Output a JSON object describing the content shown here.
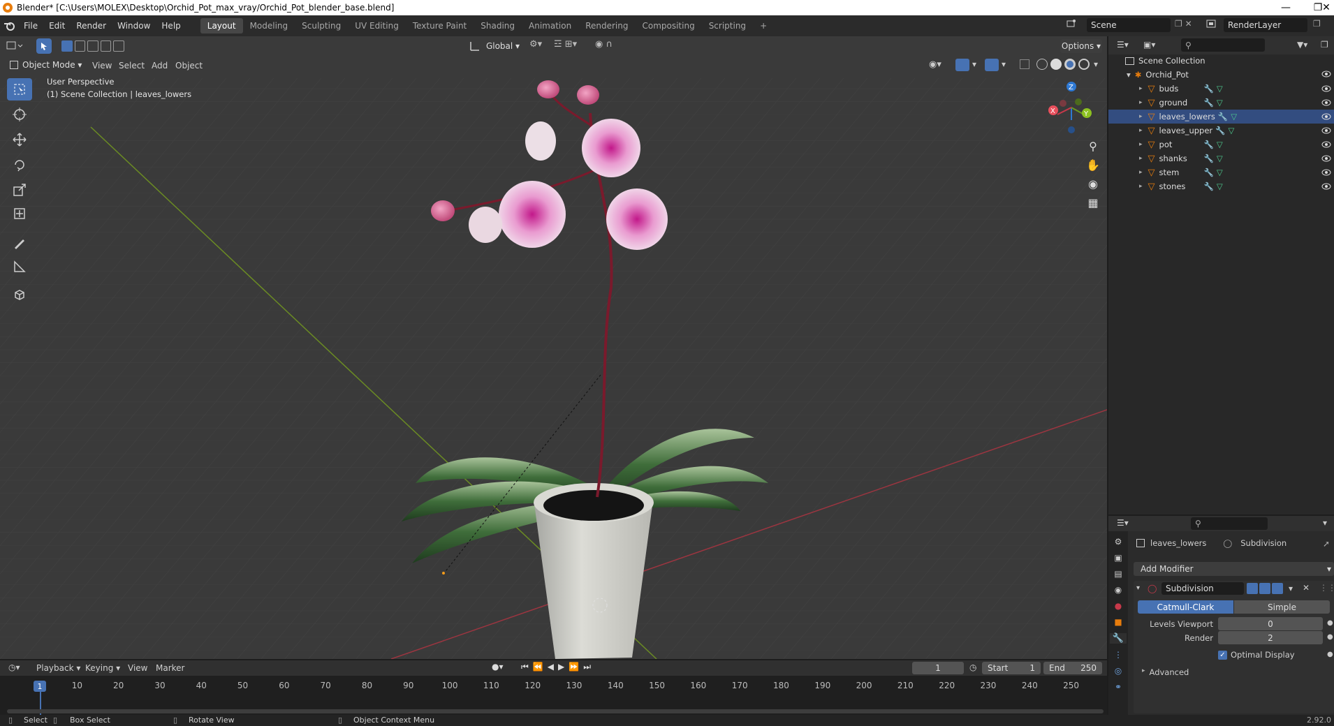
{
  "title": "Blender* [C:\\Users\\MOLEX\\Desktop\\Orchid_Pot_max_vray/Orchid_Pot_blender_base.blend]",
  "menu": [
    "File",
    "Edit",
    "Render",
    "Window",
    "Help"
  ],
  "workspaces": [
    "Layout",
    "Modeling",
    "Sculpting",
    "UV Editing",
    "Texture Paint",
    "Shading",
    "Animation",
    "Rendering",
    "Compositing",
    "Scripting"
  ],
  "scene_name": "Scene",
  "render_layer": "RenderLayer",
  "toolbar": {
    "orientation": "Global",
    "options": "Options"
  },
  "viewport": {
    "mode": "Object Mode",
    "menus": [
      "View",
      "Select",
      "Add",
      "Object"
    ],
    "perspective": "User Perspective",
    "collection_info": "(1) Scene Collection | leaves_lowers",
    "gizmo": {
      "x": "X",
      "y": "Y",
      "z": "Z"
    }
  },
  "outliner": {
    "root": "Scene Collection",
    "parent": "Orchid_Pot",
    "items": [
      "buds",
      "ground",
      "leaves_lowers",
      "leaves_upper",
      "pot",
      "shanks",
      "stem",
      "stones"
    ],
    "selected": "leaves_lowers"
  },
  "properties": {
    "object": "leaves_lowers",
    "modifier_tab": "Subdivision",
    "add_modifier": "Add Modifier",
    "modifier_name": "Subdivision",
    "mode_a": "Catmull-Clark",
    "mode_b": "Simple",
    "levels_viewport_label": "Levels Viewport",
    "levels_viewport": "0",
    "render_label": "Render",
    "render": "2",
    "optimal_display": "Optimal Display",
    "advanced": "Advanced"
  },
  "timeline": {
    "menus": [
      "Playback",
      "Keying",
      "View",
      "Marker"
    ],
    "current_frame": "1",
    "start_label": "Start",
    "start": "1",
    "end_label": "End",
    "end": "250",
    "ticks": [
      "1",
      "10",
      "20",
      "30",
      "40",
      "50",
      "60",
      "70",
      "80",
      "90",
      "100",
      "110",
      "120",
      "130",
      "140",
      "150",
      "160",
      "170",
      "180",
      "190",
      "200",
      "210",
      "220",
      "230",
      "240",
      "250"
    ]
  },
  "status": {
    "select": "Select",
    "box_select": "Box Select",
    "rotate_view": "Rotate View",
    "context_menu": "Object Context Menu",
    "version": "2.92.0"
  },
  "colors": {
    "accent": "#4772b3",
    "orange": "#e87d0d",
    "x_axis": "#c7394a",
    "y_axis": "#6b9a1f",
    "z_axis": "#2e79d4"
  }
}
